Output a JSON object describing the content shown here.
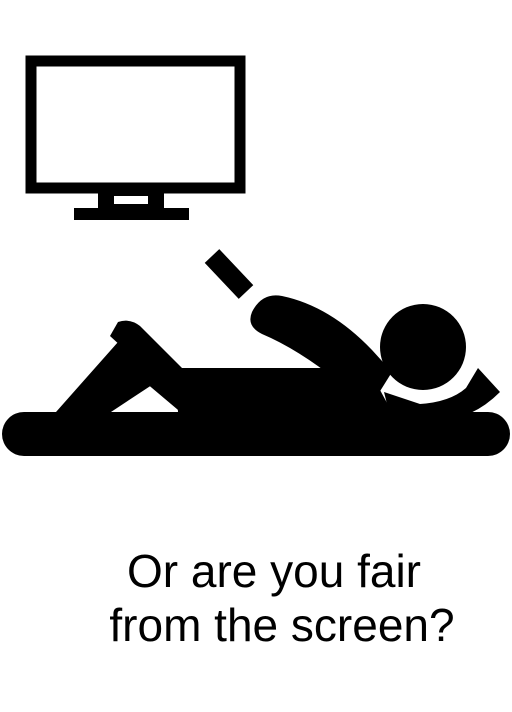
{
  "caption": {
    "line1": "Or are you fair",
    "line2": "from the screen?"
  },
  "icons": {
    "tv": "tv-monitor-icon",
    "remote": "remote-control-icon",
    "person": "person-lying-down-icon"
  },
  "colors": {
    "background": "#ffffff",
    "foreground": "#000000"
  }
}
